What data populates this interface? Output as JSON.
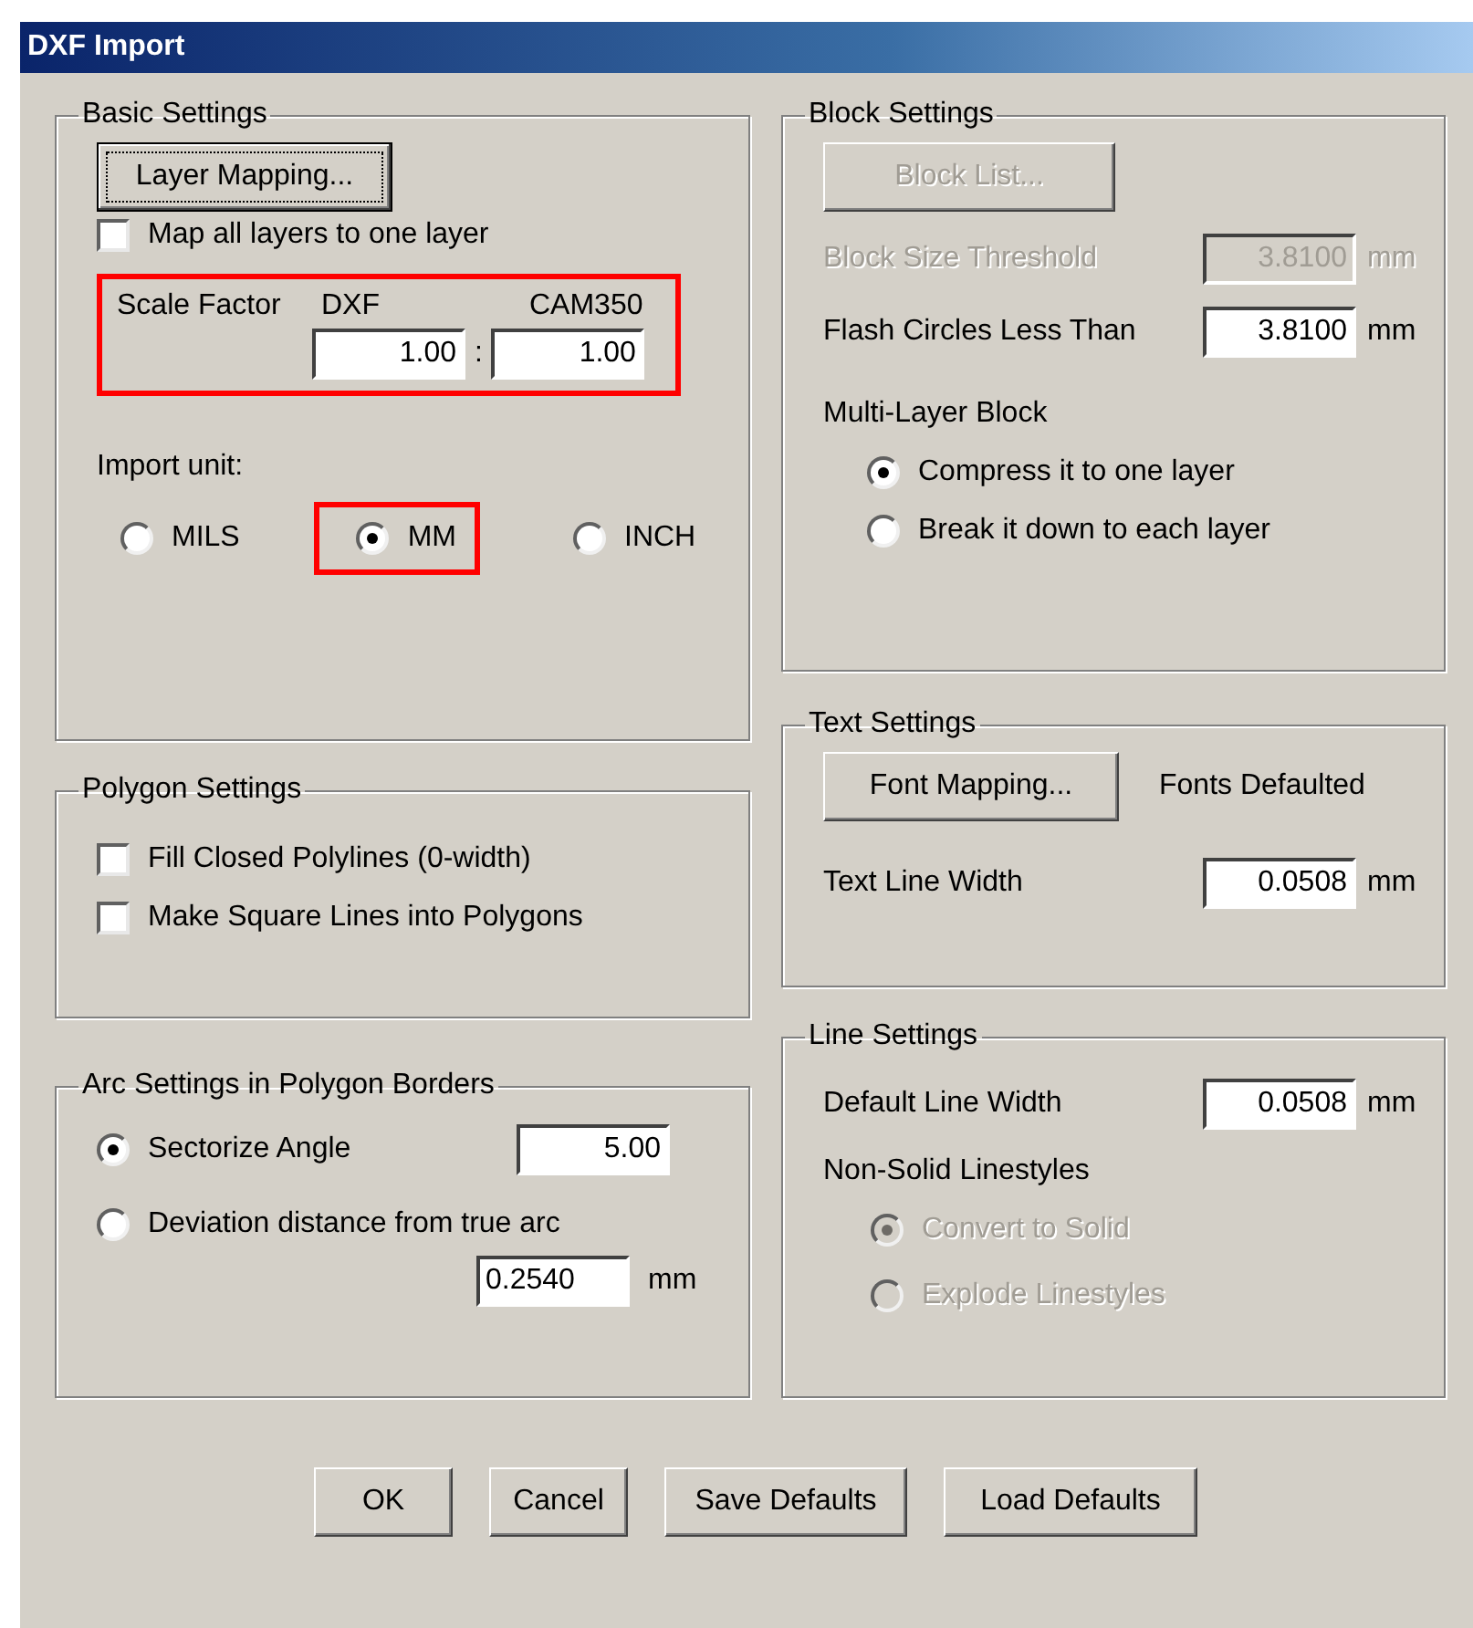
{
  "window": {
    "title": "DXF Import"
  },
  "basic_settings": {
    "title": "Basic Settings",
    "layer_mapping_button": {
      "label": "Layer Mapping...",
      "focused": true
    },
    "map_all_layers": {
      "label": "Map all layers to one layer",
      "checked": false
    },
    "scale_factor": {
      "label": "Scale Factor",
      "dxf_label": "DXF",
      "cam_label": "CAM350",
      "dxf_value": "1.00",
      "separator": ":",
      "cam_value": "1.00",
      "highlighted": true
    },
    "import_unit": {
      "label": "Import unit:",
      "options": [
        {
          "label": "MILS",
          "selected": false,
          "highlighted": false
        },
        {
          "label": "MM",
          "selected": true,
          "highlighted": true
        },
        {
          "label": "INCH",
          "selected": false,
          "highlighted": false
        }
      ]
    }
  },
  "polygon_settings": {
    "title": "Polygon Settings",
    "options": [
      {
        "label": "Fill Closed Polylines (0-width)",
        "checked": false
      },
      {
        "label": "Make Square Lines into Polygons",
        "checked": false
      }
    ]
  },
  "arc_settings": {
    "title": "Arc Settings in Polygon Borders",
    "sectorize": {
      "label": "Sectorize Angle",
      "selected": true,
      "value": "5.00"
    },
    "deviation": {
      "label": "Deviation distance from true arc",
      "selected": false,
      "value": "0.2540",
      "unit": "mm"
    }
  },
  "block_settings": {
    "title": "Block Settings",
    "block_list_button": {
      "label": "Block List...",
      "disabled": true
    },
    "threshold": {
      "label": "Block Size Threshold",
      "value": "3.8100",
      "unit": "mm",
      "disabled": true
    },
    "flash_circles": {
      "label": "Flash Circles Less Than",
      "value": "3.8100",
      "unit": "mm",
      "disabled": false
    },
    "multi_layer": {
      "label": "Multi-Layer Block",
      "disabled": false,
      "options": [
        {
          "label": "Compress it to one layer",
          "selected": true
        },
        {
          "label": "Break it down to each layer",
          "selected": false
        }
      ]
    }
  },
  "text_settings": {
    "title": "Text Settings",
    "font_mapping_button": {
      "label": "Font Mapping...",
      "focused": false
    },
    "fonts_status": "Fonts Defaulted",
    "text_line_width": {
      "label": "Text Line Width",
      "value": "0.0508",
      "unit": "mm",
      "disabled": false
    }
  },
  "line_settings": {
    "title": "Line Settings",
    "default_line_width": {
      "label": "Default Line Width",
      "value": "0.0508",
      "unit": "mm",
      "disabled": false
    },
    "non_solid": {
      "label": "Non-Solid Linestyles",
      "disabled": true,
      "options": [
        {
          "label": "Convert to Solid",
          "selected": true
        },
        {
          "label": "Explode Linestyles",
          "selected": false
        }
      ]
    }
  },
  "buttons": [
    {
      "label": "OK",
      "focused": false
    },
    {
      "label": "Cancel",
      "focused": false
    },
    {
      "label": "Save Defaults",
      "focused": false
    },
    {
      "label": "Load Defaults",
      "focused": false
    }
  ]
}
